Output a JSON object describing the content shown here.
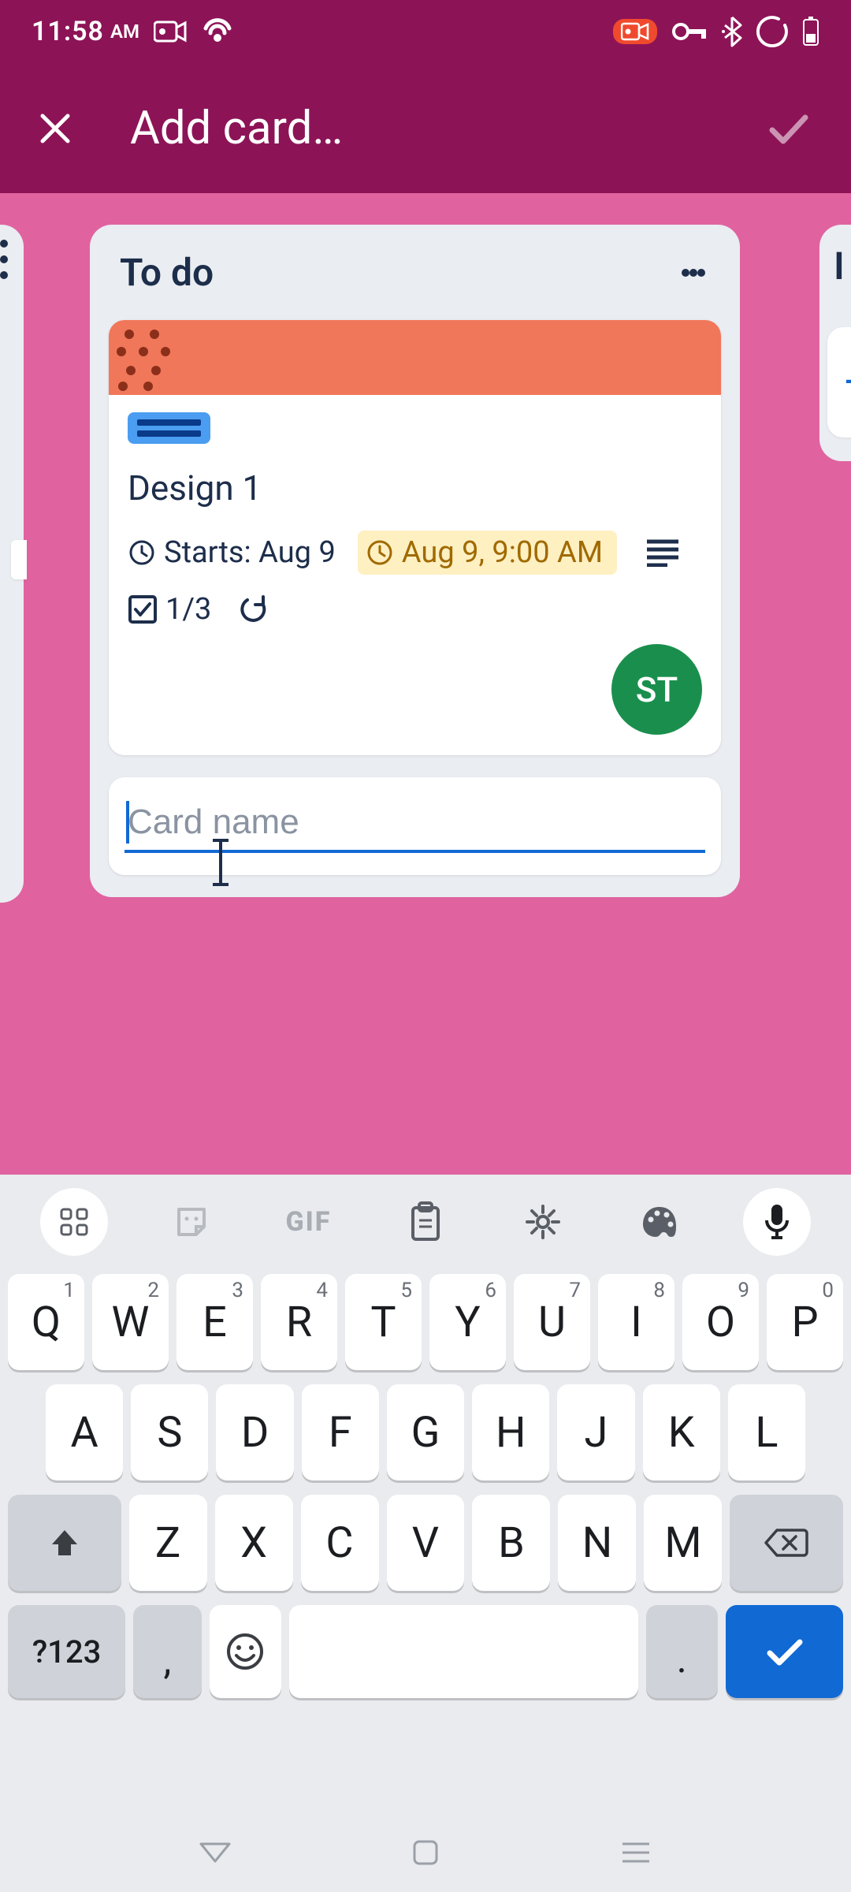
{
  "status_bar": {
    "time": "11:58",
    "ampm": "AM"
  },
  "app_bar": {
    "title": "Add card…"
  },
  "list": {
    "title": "To do",
    "peek_right_title_char": "I",
    "card": {
      "title": "Design 1",
      "start_label": "Starts: Aug 9",
      "due_label": "Aug 9, 9:00 AM",
      "checklist": "1/3",
      "avatar_initials": "ST"
    },
    "new_card": {
      "placeholder": "Card name",
      "value": ""
    }
  },
  "keyboard": {
    "gif_label": "GIF",
    "row1": [
      {
        "k": "Q",
        "s": "1"
      },
      {
        "k": "W",
        "s": "2"
      },
      {
        "k": "E",
        "s": "3"
      },
      {
        "k": "R",
        "s": "4"
      },
      {
        "k": "T",
        "s": "5"
      },
      {
        "k": "Y",
        "s": "6"
      },
      {
        "k": "U",
        "s": "7"
      },
      {
        "k": "I",
        "s": "8"
      },
      {
        "k": "O",
        "s": "9"
      },
      {
        "k": "P",
        "s": "0"
      }
    ],
    "row2": [
      "A",
      "S",
      "D",
      "F",
      "G",
      "H",
      "J",
      "K",
      "L"
    ],
    "row3": [
      "Z",
      "X",
      "C",
      "V",
      "B",
      "N",
      "M"
    ],
    "sym_label": "?123",
    "comma": ",",
    "period": "."
  }
}
